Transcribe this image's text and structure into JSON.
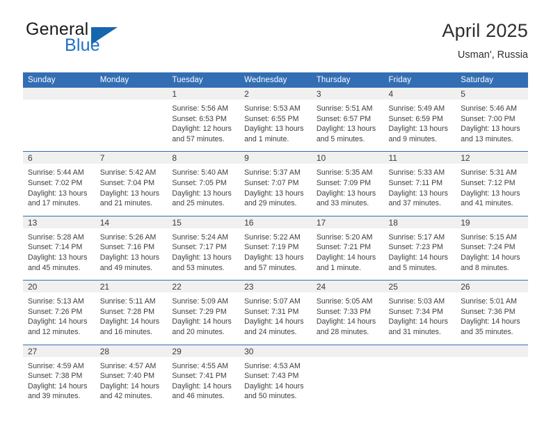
{
  "brand": {
    "line1": "General",
    "line2": "Blue",
    "triangle_color": "#1666ad"
  },
  "header": {
    "title": "April 2025",
    "subtitle": "Usman', Russia"
  },
  "colors": {
    "header_blue": "#336eb4",
    "row_divider_blue": "#2f6db3",
    "daynum_band": "#f0f0f0",
    "text": "#3d3d3d"
  },
  "weekday_headers": [
    "Sunday",
    "Monday",
    "Tuesday",
    "Wednesday",
    "Thursday",
    "Friday",
    "Saturday"
  ],
  "weeks": [
    [
      {
        "day": "",
        "sunrise": "",
        "sunset": "",
        "daylight1": "",
        "daylight2": ""
      },
      {
        "day": "",
        "sunrise": "",
        "sunset": "",
        "daylight1": "",
        "daylight2": ""
      },
      {
        "day": "1",
        "sunrise": "Sunrise: 5:56 AM",
        "sunset": "Sunset: 6:53 PM",
        "daylight1": "Daylight: 12 hours",
        "daylight2": "and 57 minutes."
      },
      {
        "day": "2",
        "sunrise": "Sunrise: 5:53 AM",
        "sunset": "Sunset: 6:55 PM",
        "daylight1": "Daylight: 13 hours",
        "daylight2": "and 1 minute."
      },
      {
        "day": "3",
        "sunrise": "Sunrise: 5:51 AM",
        "sunset": "Sunset: 6:57 PM",
        "daylight1": "Daylight: 13 hours",
        "daylight2": "and 5 minutes."
      },
      {
        "day": "4",
        "sunrise": "Sunrise: 5:49 AM",
        "sunset": "Sunset: 6:59 PM",
        "daylight1": "Daylight: 13 hours",
        "daylight2": "and 9 minutes."
      },
      {
        "day": "5",
        "sunrise": "Sunrise: 5:46 AM",
        "sunset": "Sunset: 7:00 PM",
        "daylight1": "Daylight: 13 hours",
        "daylight2": "and 13 minutes."
      }
    ],
    [
      {
        "day": "6",
        "sunrise": "Sunrise: 5:44 AM",
        "sunset": "Sunset: 7:02 PM",
        "daylight1": "Daylight: 13 hours",
        "daylight2": "and 17 minutes."
      },
      {
        "day": "7",
        "sunrise": "Sunrise: 5:42 AM",
        "sunset": "Sunset: 7:04 PM",
        "daylight1": "Daylight: 13 hours",
        "daylight2": "and 21 minutes."
      },
      {
        "day": "8",
        "sunrise": "Sunrise: 5:40 AM",
        "sunset": "Sunset: 7:05 PM",
        "daylight1": "Daylight: 13 hours",
        "daylight2": "and 25 minutes."
      },
      {
        "day": "9",
        "sunrise": "Sunrise: 5:37 AM",
        "sunset": "Sunset: 7:07 PM",
        "daylight1": "Daylight: 13 hours",
        "daylight2": "and 29 minutes."
      },
      {
        "day": "10",
        "sunrise": "Sunrise: 5:35 AM",
        "sunset": "Sunset: 7:09 PM",
        "daylight1": "Daylight: 13 hours",
        "daylight2": "and 33 minutes."
      },
      {
        "day": "11",
        "sunrise": "Sunrise: 5:33 AM",
        "sunset": "Sunset: 7:11 PM",
        "daylight1": "Daylight: 13 hours",
        "daylight2": "and 37 minutes."
      },
      {
        "day": "12",
        "sunrise": "Sunrise: 5:31 AM",
        "sunset": "Sunset: 7:12 PM",
        "daylight1": "Daylight: 13 hours",
        "daylight2": "and 41 minutes."
      }
    ],
    [
      {
        "day": "13",
        "sunrise": "Sunrise: 5:28 AM",
        "sunset": "Sunset: 7:14 PM",
        "daylight1": "Daylight: 13 hours",
        "daylight2": "and 45 minutes."
      },
      {
        "day": "14",
        "sunrise": "Sunrise: 5:26 AM",
        "sunset": "Sunset: 7:16 PM",
        "daylight1": "Daylight: 13 hours",
        "daylight2": "and 49 minutes."
      },
      {
        "day": "15",
        "sunrise": "Sunrise: 5:24 AM",
        "sunset": "Sunset: 7:17 PM",
        "daylight1": "Daylight: 13 hours",
        "daylight2": "and 53 minutes."
      },
      {
        "day": "16",
        "sunrise": "Sunrise: 5:22 AM",
        "sunset": "Sunset: 7:19 PM",
        "daylight1": "Daylight: 13 hours",
        "daylight2": "and 57 minutes."
      },
      {
        "day": "17",
        "sunrise": "Sunrise: 5:20 AM",
        "sunset": "Sunset: 7:21 PM",
        "daylight1": "Daylight: 14 hours",
        "daylight2": "and 1 minute."
      },
      {
        "day": "18",
        "sunrise": "Sunrise: 5:17 AM",
        "sunset": "Sunset: 7:23 PM",
        "daylight1": "Daylight: 14 hours",
        "daylight2": "and 5 minutes."
      },
      {
        "day": "19",
        "sunrise": "Sunrise: 5:15 AM",
        "sunset": "Sunset: 7:24 PM",
        "daylight1": "Daylight: 14 hours",
        "daylight2": "and 8 minutes."
      }
    ],
    [
      {
        "day": "20",
        "sunrise": "Sunrise: 5:13 AM",
        "sunset": "Sunset: 7:26 PM",
        "daylight1": "Daylight: 14 hours",
        "daylight2": "and 12 minutes."
      },
      {
        "day": "21",
        "sunrise": "Sunrise: 5:11 AM",
        "sunset": "Sunset: 7:28 PM",
        "daylight1": "Daylight: 14 hours",
        "daylight2": "and 16 minutes."
      },
      {
        "day": "22",
        "sunrise": "Sunrise: 5:09 AM",
        "sunset": "Sunset: 7:29 PM",
        "daylight1": "Daylight: 14 hours",
        "daylight2": "and 20 minutes."
      },
      {
        "day": "23",
        "sunrise": "Sunrise: 5:07 AM",
        "sunset": "Sunset: 7:31 PM",
        "daylight1": "Daylight: 14 hours",
        "daylight2": "and 24 minutes."
      },
      {
        "day": "24",
        "sunrise": "Sunrise: 5:05 AM",
        "sunset": "Sunset: 7:33 PM",
        "daylight1": "Daylight: 14 hours",
        "daylight2": "and 28 minutes."
      },
      {
        "day": "25",
        "sunrise": "Sunrise: 5:03 AM",
        "sunset": "Sunset: 7:34 PM",
        "daylight1": "Daylight: 14 hours",
        "daylight2": "and 31 minutes."
      },
      {
        "day": "26",
        "sunrise": "Sunrise: 5:01 AM",
        "sunset": "Sunset: 7:36 PM",
        "daylight1": "Daylight: 14 hours",
        "daylight2": "and 35 minutes."
      }
    ],
    [
      {
        "day": "27",
        "sunrise": "Sunrise: 4:59 AM",
        "sunset": "Sunset: 7:38 PM",
        "daylight1": "Daylight: 14 hours",
        "daylight2": "and 39 minutes."
      },
      {
        "day": "28",
        "sunrise": "Sunrise: 4:57 AM",
        "sunset": "Sunset: 7:40 PM",
        "daylight1": "Daylight: 14 hours",
        "daylight2": "and 42 minutes."
      },
      {
        "day": "29",
        "sunrise": "Sunrise: 4:55 AM",
        "sunset": "Sunset: 7:41 PM",
        "daylight1": "Daylight: 14 hours",
        "daylight2": "and 46 minutes."
      },
      {
        "day": "30",
        "sunrise": "Sunrise: 4:53 AM",
        "sunset": "Sunset: 7:43 PM",
        "daylight1": "Daylight: 14 hours",
        "daylight2": "and 50 minutes."
      },
      {
        "day": "",
        "sunrise": "",
        "sunset": "",
        "daylight1": "",
        "daylight2": ""
      },
      {
        "day": "",
        "sunrise": "",
        "sunset": "",
        "daylight1": "",
        "daylight2": ""
      },
      {
        "day": "",
        "sunrise": "",
        "sunset": "",
        "daylight1": "",
        "daylight2": ""
      }
    ]
  ]
}
